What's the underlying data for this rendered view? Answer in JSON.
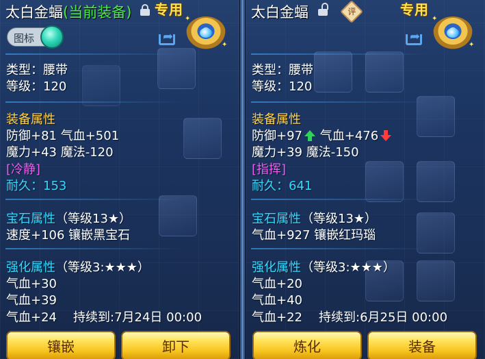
{
  "left": {
    "title_name": "太白金蝠",
    "title_tag": "(当前装备)",
    "special": "专用",
    "toggle_label": "图标",
    "type_line": "类型：腰带",
    "level_line": "等级：120",
    "attr_header": "装备属性",
    "attr1": "防御+81 气血+501",
    "attr2": "魔力+43 魔法-120",
    "special_skill": "[冷静]",
    "durability_label": "耐久：",
    "durability_value": "153",
    "gem_header": "宝石属性",
    "gem_level": "（等级13★）",
    "gem_line": "速度+106 镶嵌黑宝石",
    "forge_header": "强化属性",
    "forge_level": "（等级3:★★★）",
    "forge1": "气血+30",
    "forge2": "气血+39",
    "forge3": "气血+24",
    "forge3_expire": "持续到:7月24日 00:00",
    "button1": "镶嵌",
    "button2": "卸下",
    "lock_icon": "lock-closed-icon"
  },
  "right": {
    "title_name": "太白金蝠",
    "special": "专用",
    "rate_badge": "评",
    "type_line": "类型：腰带",
    "level_line": "等级：120",
    "attr_header": "装备属性",
    "attr1a": "防御+97",
    "attr1b": "气血+476",
    "attr2": "魔力+39 魔法-150",
    "special_skill": "[指挥]",
    "durability_label": "耐久：",
    "durability_value": "641",
    "gem_header": "宝石属性",
    "gem_level": "（等级13★）",
    "gem_line": "气血+927 镶嵌红玛瑙",
    "forge_header": "强化属性",
    "forge_level": "（等级3:★★★）",
    "forge1": "气血+20",
    "forge2": "气血+40",
    "forge3": "气血+22",
    "forge3_expire": "持续到:6月25日 00:00",
    "button1": "炼化",
    "button2": "装备",
    "lock_icon": "lock-open-icon"
  },
  "colors": {
    "section_header": "#ffd24a",
    "equipped_tag": "#4eea46",
    "special_skill": "#f05cf0",
    "durability": "#33d9ff",
    "increase": "#2fd35a",
    "decrease": "#ff3b3b",
    "button_gold": "#f6c31d"
  }
}
